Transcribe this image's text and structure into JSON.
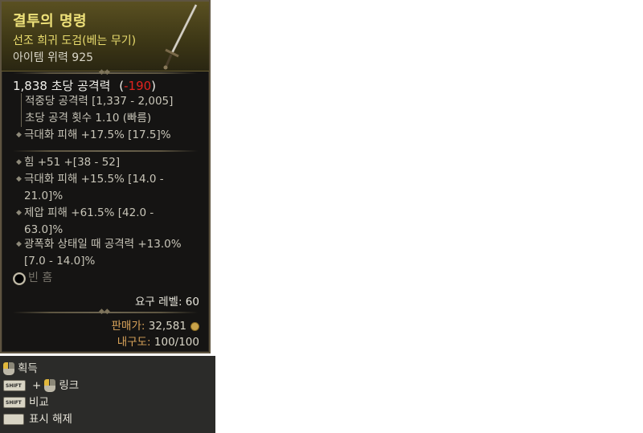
{
  "item": {
    "name": "결투의 명령",
    "type": "선조 희귀 도검(베는 무기)",
    "power": "아이템 위력 925",
    "dps_value": "1,838 초당 공격력",
    "dps_delta": "-190",
    "substats": [
      "적중당 공격력 [1,337 - 2,005]",
      "초당 공격 횟수 1.10 (빠름)"
    ],
    "implicit": "극대화 피해 +17.5% [17.5]%",
    "affixes": [
      {
        "line1": "힘 +51 +[38 - 52]",
        "line2": ""
      },
      {
        "line1": "극대화 피해 +15.5% [14.0 -",
        "line2": "21.0]%"
      },
      {
        "line1": "제압 피해 +61.5% [42.0 -",
        "line2": "63.0]%"
      },
      {
        "line1": "광폭화 상태일 때 공격력 +13.0%",
        "line2": "[7.0 - 14.0]%"
      }
    ],
    "socket_label": "빈 홈",
    "required_level": "요구 레벨: 60",
    "sell_label": "판매가:",
    "sell_value": "32,581",
    "durability_label": "내구도:",
    "durability_value": "100/100"
  },
  "controls": {
    "acquire": "획득",
    "link": "링크",
    "compare": "비교",
    "unmark": "표시 해제",
    "plus": "+",
    "shift_key": "SHIFT"
  },
  "colors": {
    "title": "#efe27a",
    "negative": "#e0231f",
    "gold": "#d9a35a"
  }
}
